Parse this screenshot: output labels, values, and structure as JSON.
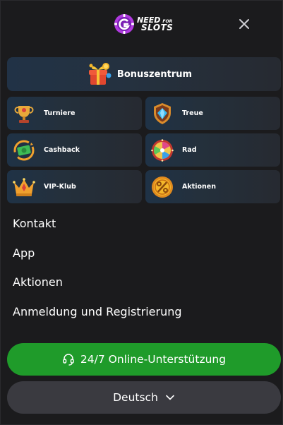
{
  "header": {
    "logo_line1": "NEED",
    "logo_for": "FOR",
    "logo_line2": "SLOTS",
    "close_icon": "close-icon"
  },
  "bonus": {
    "label": "Bonuszentrum",
    "icon": "gift-icon"
  },
  "tiles": [
    {
      "label": "Turniere",
      "icon": "trophy-icon"
    },
    {
      "label": "Treue",
      "icon": "diamond-shield-icon"
    },
    {
      "label": "Cashback",
      "icon": "cash-icon"
    },
    {
      "label": "Rad",
      "icon": "wheel-icon"
    },
    {
      "label": "VIP-Klub",
      "icon": "crown-icon"
    },
    {
      "label": "Aktionen",
      "icon": "percent-coin-icon"
    }
  ],
  "links": [
    "Kontakt",
    "App",
    "Aktionen",
    "Anmeldung und Registrierung"
  ],
  "support": {
    "label": "24/7 Online-Unterstützung",
    "icon": "headset-icon"
  },
  "language": {
    "label": "Deutsch",
    "icon": "chevron-down-icon"
  },
  "colors": {
    "background": "#1b1b1d",
    "support_green": "#1f9b2a",
    "language_bg": "#3a3a40",
    "brand_purple": "#b03adf"
  }
}
